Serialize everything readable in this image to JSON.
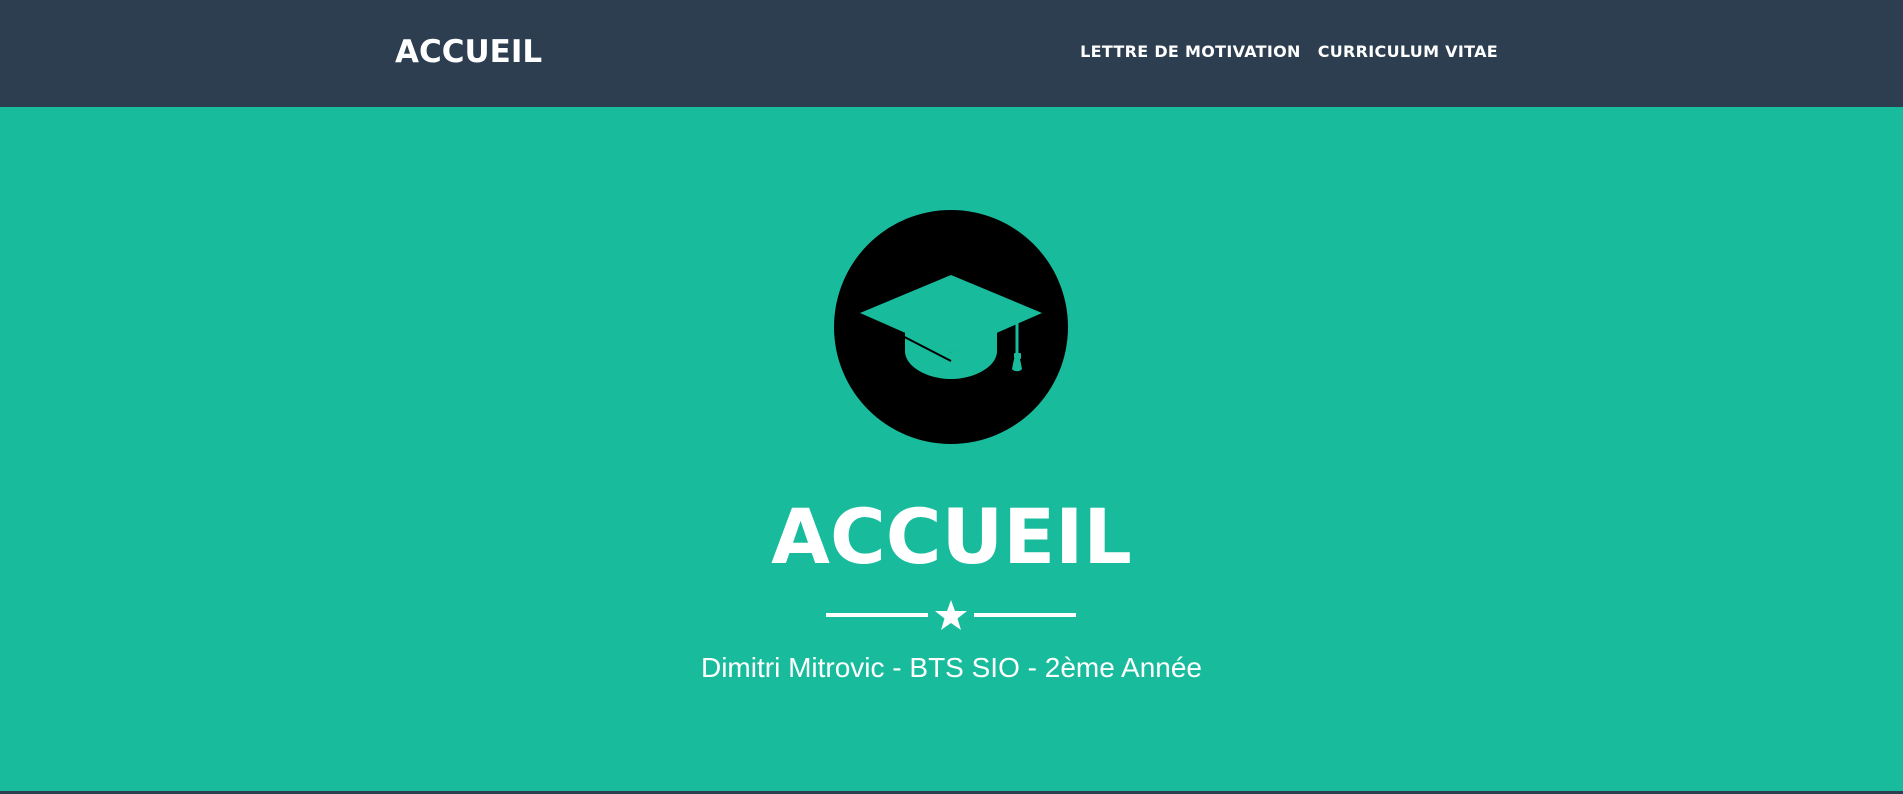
{
  "navbar": {
    "brand": "ACCUEIL",
    "links": [
      {
        "label": "LETTRE DE MOTIVATION"
      },
      {
        "label": "CURRICULUM VITAE"
      }
    ]
  },
  "hero": {
    "icon": "graduation-cap-icon",
    "title": "ACCUEIL",
    "divider_icon": "star-icon",
    "subtitle": "Dimitri Mitrovic - BTS SIO - 2ème Année"
  },
  "colors": {
    "navbar_bg": "#2c3e50",
    "hero_bg": "#18bc9c",
    "text": "#ffffff",
    "icon_circle": "#000000"
  }
}
